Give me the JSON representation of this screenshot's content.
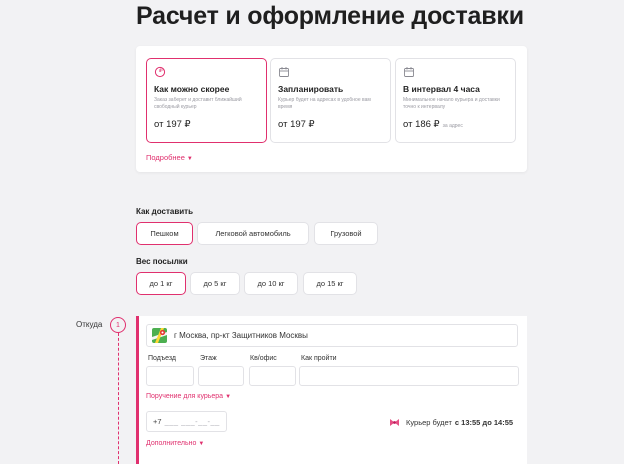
{
  "page": {
    "title": "Расчет и оформление доставки"
  },
  "colors": {
    "accent": "#e0306e",
    "border": "#e2e2e6",
    "background": "#f2f2f4"
  },
  "tariffs": {
    "items": [
      {
        "icon": "clock-icon",
        "title": "Как можно скорее",
        "desc": "Заказ заберет и доставит ближайший свободный курьер",
        "price": "от 197 ₽",
        "note": "",
        "active": true
      },
      {
        "icon": "calendar-icon",
        "title": "Запланировать",
        "desc": "Курьер будет на адресах в удобное вам время",
        "price": "от 197 ₽",
        "note": "",
        "active": false
      },
      {
        "icon": "calendar-icon",
        "title": "В интервал 4 часа",
        "desc": "Минимальное начало курьера и доставки точно к интервалу",
        "price": "от 186 ₽",
        "note": "за адрес",
        "active": false
      }
    ],
    "more_label": "Подробнее"
  },
  "delivery_method": {
    "label": "Как доставить",
    "options": [
      "Пешком",
      "Легковой автомобиль",
      "Грузовой"
    ],
    "selected": "Пешком"
  },
  "weight": {
    "label": "Вес посылки",
    "options": [
      "до 1 кг",
      "до 5 кг",
      "до 10 кг",
      "до 15 кг"
    ],
    "selected": "до 1 кг"
  },
  "from": {
    "label": "Откуда",
    "step": "1",
    "address": "г Москва, пр-кт Защитников Москвы",
    "fields": [
      "Подъезд",
      "Этаж",
      "Кв/офис",
      "Как пройти"
    ],
    "courier_link": "Поручение для курьера",
    "phone_prefix": "+7",
    "phone_mask": "___ ___-__-__",
    "eta_prefix": "Курьер будет",
    "eta_time": "с 13:55 до 14:55",
    "extra_link": "Дополнительно"
  }
}
